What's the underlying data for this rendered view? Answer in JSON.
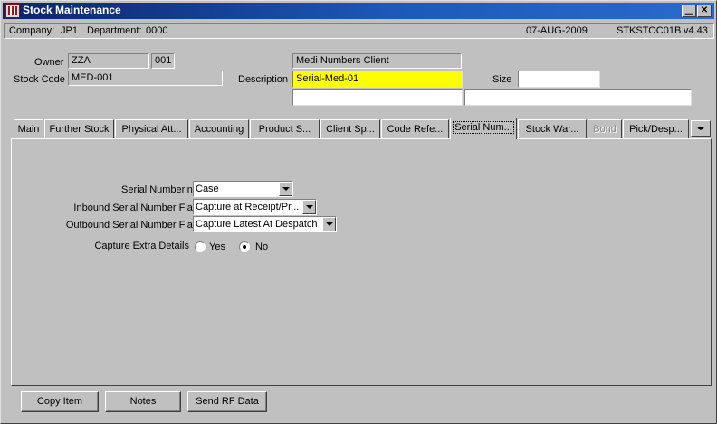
{
  "window": {
    "title": "Stock Maintenance",
    "min_glyph": "▁",
    "close_glyph": "✕"
  },
  "info": {
    "company_label": "Company:",
    "company": "JP1",
    "department_label": "Department:",
    "department": "0000",
    "date": "07-AUG-2009",
    "program": "STKSTOC01B",
    "version": "v4.43"
  },
  "header": {
    "owner_label": "Owner",
    "owner_code": "ZZA",
    "owner_num": "001",
    "owner_name": "Medi Numbers Client",
    "stock_code_label": "Stock Code",
    "stock_code": "MED-001",
    "description_label": "Description",
    "description": "Serial-Med-01",
    "description_line2": "",
    "description_line3": "",
    "size_label": "Size",
    "size": ""
  },
  "tabs": [
    {
      "label": "Main"
    },
    {
      "label": "Further Stock"
    },
    {
      "label": "Physical Att..."
    },
    {
      "label": "Accounting"
    },
    {
      "label": "Product S..."
    },
    {
      "label": "Client Sp..."
    },
    {
      "label": "Code Refe..."
    },
    {
      "label": "Serial Num..."
    },
    {
      "label": "Stock War..."
    },
    {
      "label": "Bond"
    },
    {
      "label": "Pick/Desp..."
    }
  ],
  "tab_scroll_glyph": "◂▸",
  "serial": {
    "numbering_label": "Serial Numbering",
    "numbering_value": "Case",
    "inbound_label": "Inbound Serial Number Flag",
    "inbound_value": "Capture at Receipt/Pr...",
    "outbound_label": "Outbound Serial Number Flag",
    "outbound_value": "Capture Latest At Despatch",
    "extra_label": "Capture Extra Details",
    "yes_label": "Yes",
    "no_label": "No",
    "extra_selected": "No"
  },
  "buttons": {
    "copy_item": "Copy Item",
    "notes": "Notes",
    "send_rf": "Send RF Data"
  },
  "colors": {
    "title_bar": "#0a246a",
    "highlight_field": "#ffff00",
    "face": "#c0c0c0"
  }
}
